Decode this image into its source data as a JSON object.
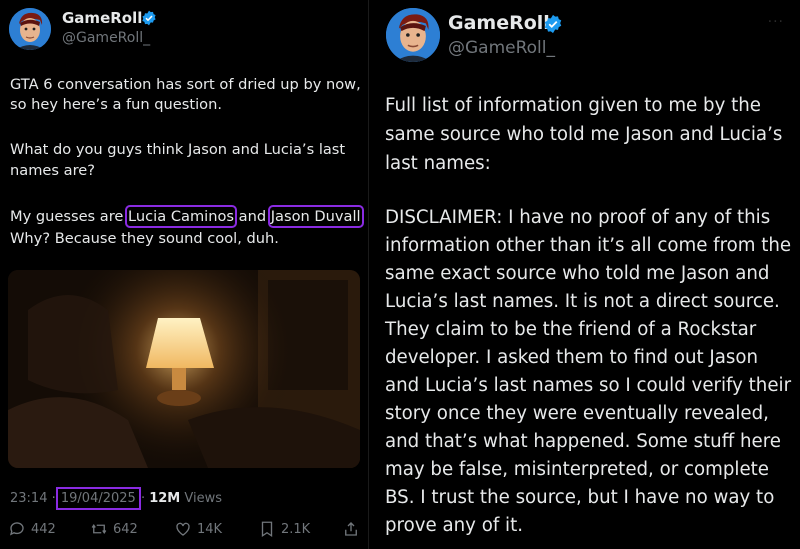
{
  "left_post": {
    "author_name": "GameRoll",
    "handle": "@GameRoll_",
    "lines": [
      "GTA 6 conversation has sort of dried up by now,",
      "so hey here’s a fun question.",
      "What do you guys think Jason and Lucia’s last",
      "names are?",
      "My guesses are ",
      "Lucia Caminos",
      " and ",
      "Jason Duvall",
      "Why? Because they sound cool, duh."
    ],
    "time": "23:14",
    "date": "19/04/2025",
    "views_count": "12M",
    "views_label": "Views",
    "replies": "442",
    "reposts": "642",
    "likes": "14K",
    "bookmarks": "2.1K"
  },
  "right_post": {
    "author_name": "GameRoll",
    "handle": "@GameRoll_",
    "lines": [
      "Full list of information given to me by the",
      "same source who told me Jason and Lucia’s",
      "last names:",
      "DISCLAIMER: I have no proof of any of this",
      "information other than it’s all come from the",
      "same exact source who told me Jason and",
      "Lucia’s last names. It is not a direct source.",
      "They claim to be the friend of a Rockstar",
      "developer. I asked them to find out Jason",
      "and Lucia’s last names so I could verify their",
      "story once they were eventually revealed,",
      "and that’s what happened. Some stuff here",
      "may be false, misinterpreted, or complete",
      "BS. I trust the source, but I have no way to",
      "prove any of it."
    ]
  },
  "colors": {
    "background": "#000000",
    "text": "#e7e9ea",
    "muted": "#71767b",
    "verified": "#1d9bf0",
    "highlight": "#8a2be2",
    "avatar_bg": "#2d7fd4"
  },
  "icons": [
    "verified-badge-icon",
    "reply-icon",
    "repost-icon",
    "like-icon",
    "bookmark-icon",
    "share-icon",
    "more-icon"
  ]
}
